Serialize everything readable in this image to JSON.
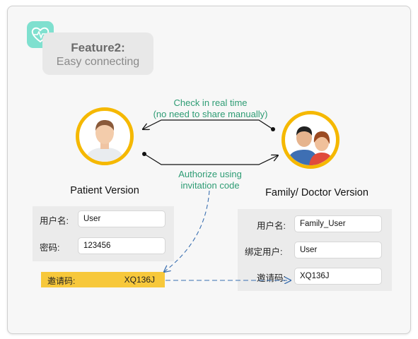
{
  "feature": {
    "title": "Feature2:",
    "subtitle": "Easy connecting"
  },
  "icons": {
    "app": "heart-pulse-icon",
    "patient": "person-avatar-icon",
    "family": "couple-avatar-icon"
  },
  "annotations": {
    "realtime_line1": "Check in real time",
    "realtime_line2": "(no need to share manually)",
    "authorize_line1": "Authorize using",
    "authorize_line2": "invitation code"
  },
  "patient": {
    "caption": "Patient Version",
    "username_label": "用户名:",
    "username_value": "User",
    "password_label": "密码:",
    "password_value": "123456",
    "invite_label": "邀请码:",
    "invite_value": "XQ136J"
  },
  "family": {
    "caption": "Family/ Doctor Version",
    "username_label": "用户名:",
    "username_value": "Family_User",
    "bound_label": "绑定用户:",
    "bound_value": "User",
    "invite_label": "邀请码:",
    "invite_value": "XQ136J"
  },
  "colors": {
    "accent": "#f5b800",
    "annotation": "#2e9c74",
    "invite_bar": "#f7c83b",
    "dashed_arrow": "#3a6fb0",
    "app_icon": "#7fe0cf"
  }
}
